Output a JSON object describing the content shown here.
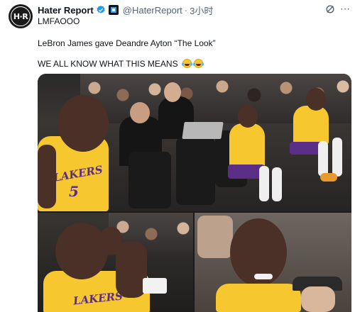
{
  "tweet": {
    "display_name": "Hater Report",
    "handle": "@HaterReport",
    "separator": "·",
    "time": "3小时",
    "avatar_text": "H·R",
    "line1": "LMFAOOO",
    "line2": "LeBron James gave Deandre Ayton “The Look”",
    "line3": "WE ALL KNOW WHAT THIS MEANS"
  },
  "media": {
    "jersey_text_top": "LAKERS",
    "jersey_number_top": "5",
    "jersey_text_bottom": "LAKERS"
  },
  "icons": {
    "verified": "verified-badge-icon",
    "affiliate": "affiliate-badge-icon",
    "grok": "grok-icon",
    "more": "more-icon",
    "emoji": "tears-of-joy-emoji"
  },
  "colors": {
    "verified": "#1d9bf0",
    "lakers_gold": "#f6c72e",
    "lakers_purple": "#5a2d86",
    "secondary_text": "#536471"
  }
}
